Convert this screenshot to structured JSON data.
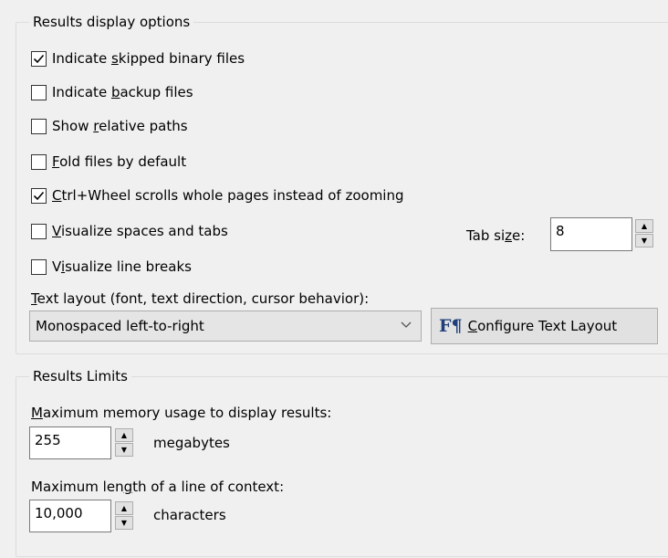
{
  "results_display": {
    "title": "Results display options",
    "options": [
      {
        "pre": "Indicate ",
        "acc": "s",
        "post": "kipped binary files",
        "checked": true
      },
      {
        "pre": "Indicate ",
        "acc": "b",
        "post": "ackup files",
        "checked": false
      },
      {
        "pre": "Show ",
        "acc": "r",
        "post": "elative paths",
        "checked": false
      },
      {
        "pre": "",
        "acc": "F",
        "post": "old files by default",
        "checked": false
      },
      {
        "pre": "",
        "acc": "C",
        "post": "trl+Wheel scrolls whole pages instead of zooming",
        "checked": true
      },
      {
        "pre": "",
        "acc": "V",
        "post": "isualize spaces and tabs",
        "checked": false
      },
      {
        "pre": "V",
        "acc": "i",
        "post": "sualize line breaks",
        "checked": false
      }
    ],
    "tab_size": {
      "pre": "Tab si",
      "acc": "z",
      "post": "e:",
      "value": "8"
    },
    "text_layout": {
      "label_acc": "T",
      "label_post": "ext layout (font, text direction, cursor behavior):",
      "selected": "Monospaced left-to-right",
      "configure_button": {
        "icon_glyph": "F¶",
        "acc": "C",
        "post": "onfigure Text Layout"
      }
    }
  },
  "results_limits": {
    "title": "Results Limits",
    "memory": {
      "label_acc": "M",
      "label_post": "aximum memory usage to display results:",
      "value": "255",
      "unit": "megabytes"
    },
    "line_length": {
      "label_pre": "Maximum len",
      "label_acc": "g",
      "label_post": "th of a line of context:",
      "value": "10,000",
      "unit": "characters"
    }
  }
}
